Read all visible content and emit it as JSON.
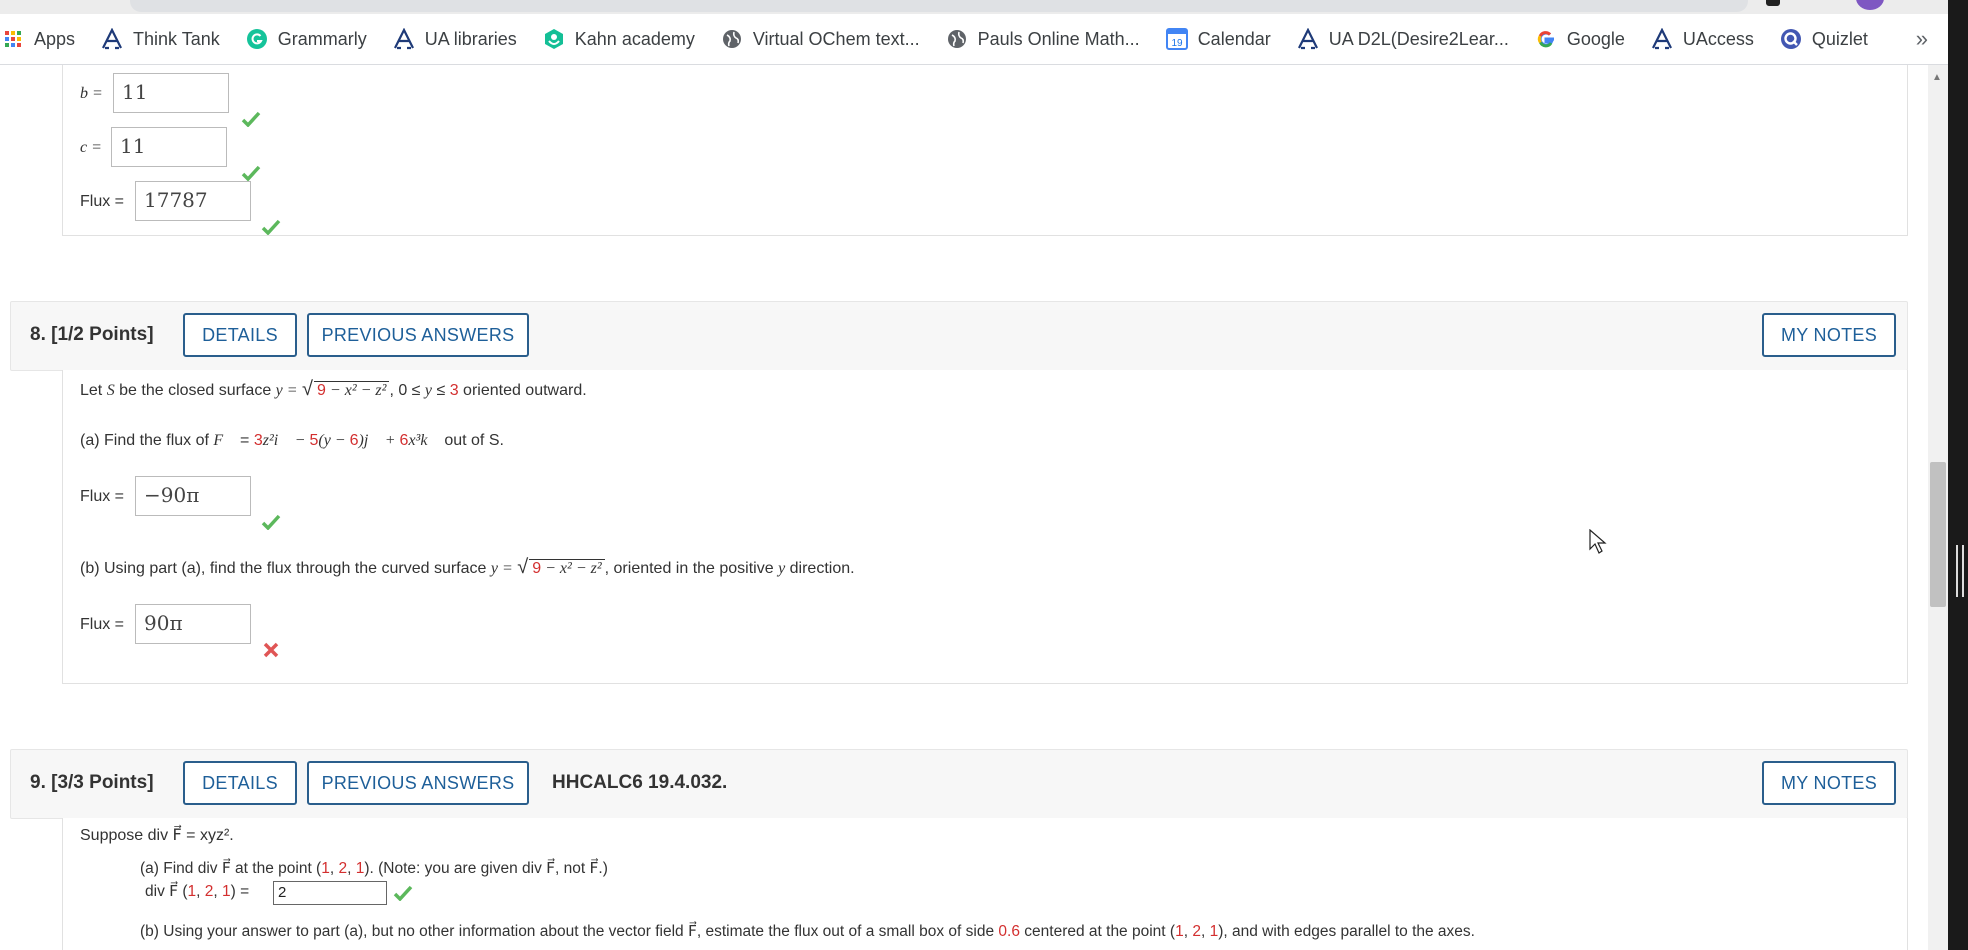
{
  "bookmarks": [
    {
      "label": "Apps",
      "icon": "apps-grid-icon"
    },
    {
      "label": "Think Tank",
      "icon": "arizona-a-icon"
    },
    {
      "label": "Grammarly",
      "icon": "grammarly-icon"
    },
    {
      "label": "UA libraries",
      "icon": "arizona-a-icon"
    },
    {
      "label": "Kahn academy",
      "icon": "khan-academy-icon"
    },
    {
      "label": "Virtual OChem text...",
      "icon": "globe-icon"
    },
    {
      "label": "Pauls Online Math...",
      "icon": "globe-icon"
    },
    {
      "label": "Calendar",
      "icon": "calendar-icon",
      "icon_text": "19"
    },
    {
      "label": "UA D2L(Desire2Lear...",
      "icon": "arizona-a-icon"
    },
    {
      "label": "Google",
      "icon": "google-g-icon"
    },
    {
      "label": "UAccess",
      "icon": "arizona-a-icon"
    },
    {
      "label": "Quizlet",
      "icon": "quizlet-icon"
    }
  ],
  "bookmarks_more": "»",
  "q7": {
    "b_label": "b =",
    "b_value": "11",
    "c_label": "c =",
    "c_value": "11",
    "flux_label": "Flux =",
    "flux_value": "17787"
  },
  "q8": {
    "number": "8.  [1/2 Points]",
    "details": "DETAILS",
    "previous": "PREVIOUS ANSWERS",
    "notes": "MY NOTES",
    "intro_a": "Let ",
    "intro_S": "S",
    "intro_b": " be the closed surface  ",
    "intro_eq": "y =",
    "radicand_9": "9",
    "radicand_rest": " − x² − z²",
    "intro_c": ",  0 ≤ ",
    "intro_y": "y",
    "intro_d": " ≤ ",
    "intro_3": "3",
    "intro_e": "  oriented outward.",
    "a_prefix": "(a) Find the flux of   ",
    "a_F": "F⃗",
    "a_eq": " = ",
    "a_3": "3",
    "a_t1": "z²i⃗ − ",
    "a_5": "5",
    "a_t2": "(y − ",
    "a_6": "6",
    "a_t3": ")j⃗ + ",
    "a_6b": "6",
    "a_t4": "x³k⃗",
    "a_suffix": "   out of S.",
    "a_flux_label": "Flux =",
    "a_flux_value": "−90π",
    "b_prefix": "(b) Using part (a), find the flux through the curved surface  ",
    "b_eq": "y =",
    "b_radicand_9": "9",
    "b_radicand_rest": " − x² − z²",
    "b_suffix": ", oriented in the positive ",
    "b_y": "y",
    "b_suffix2": " direction.",
    "b_flux_label": "Flux =",
    "b_flux_value": "90π"
  },
  "q9": {
    "number": "9.  [3/3 Points]",
    "details": "DETAILS",
    "previous": "PREVIOUS ANSWERS",
    "code": "HHCALC6 19.4.032.",
    "notes": "MY NOTES",
    "suppose": "Suppose  div F⃗ = xyz².",
    "a_text_1": "(a) Find  div F⃗  at the point  (",
    "a_1": "1",
    "a_c1": ", ",
    "a_2": "2",
    "a_c2": ", ",
    "a_1b": "1",
    "a_text_2": ").  (Note: you are given  div F⃗,  not  F⃗.)",
    "a_line2_1": "div F⃗ (",
    "a_line2_2": ") =",
    "a_answer": "2",
    "b_text_1": "(b) Using your answer to part (a), but no other information about the vector field  F⃗,  estimate the flux out of a small box of side ",
    "b_side": "0.6",
    "b_text_2": " centered at the point  (",
    "b_p1": "1",
    "b_pc1": ", ",
    "b_p2": "2",
    "b_pc2": ", ",
    "b_p3": "1",
    "b_text_3": "), and with edges parallel to the axes."
  },
  "colors": {
    "accent": "#1e5f99",
    "correct": "#5cb85c",
    "incorrect": "#e05555",
    "given": "#d32f2f"
  }
}
